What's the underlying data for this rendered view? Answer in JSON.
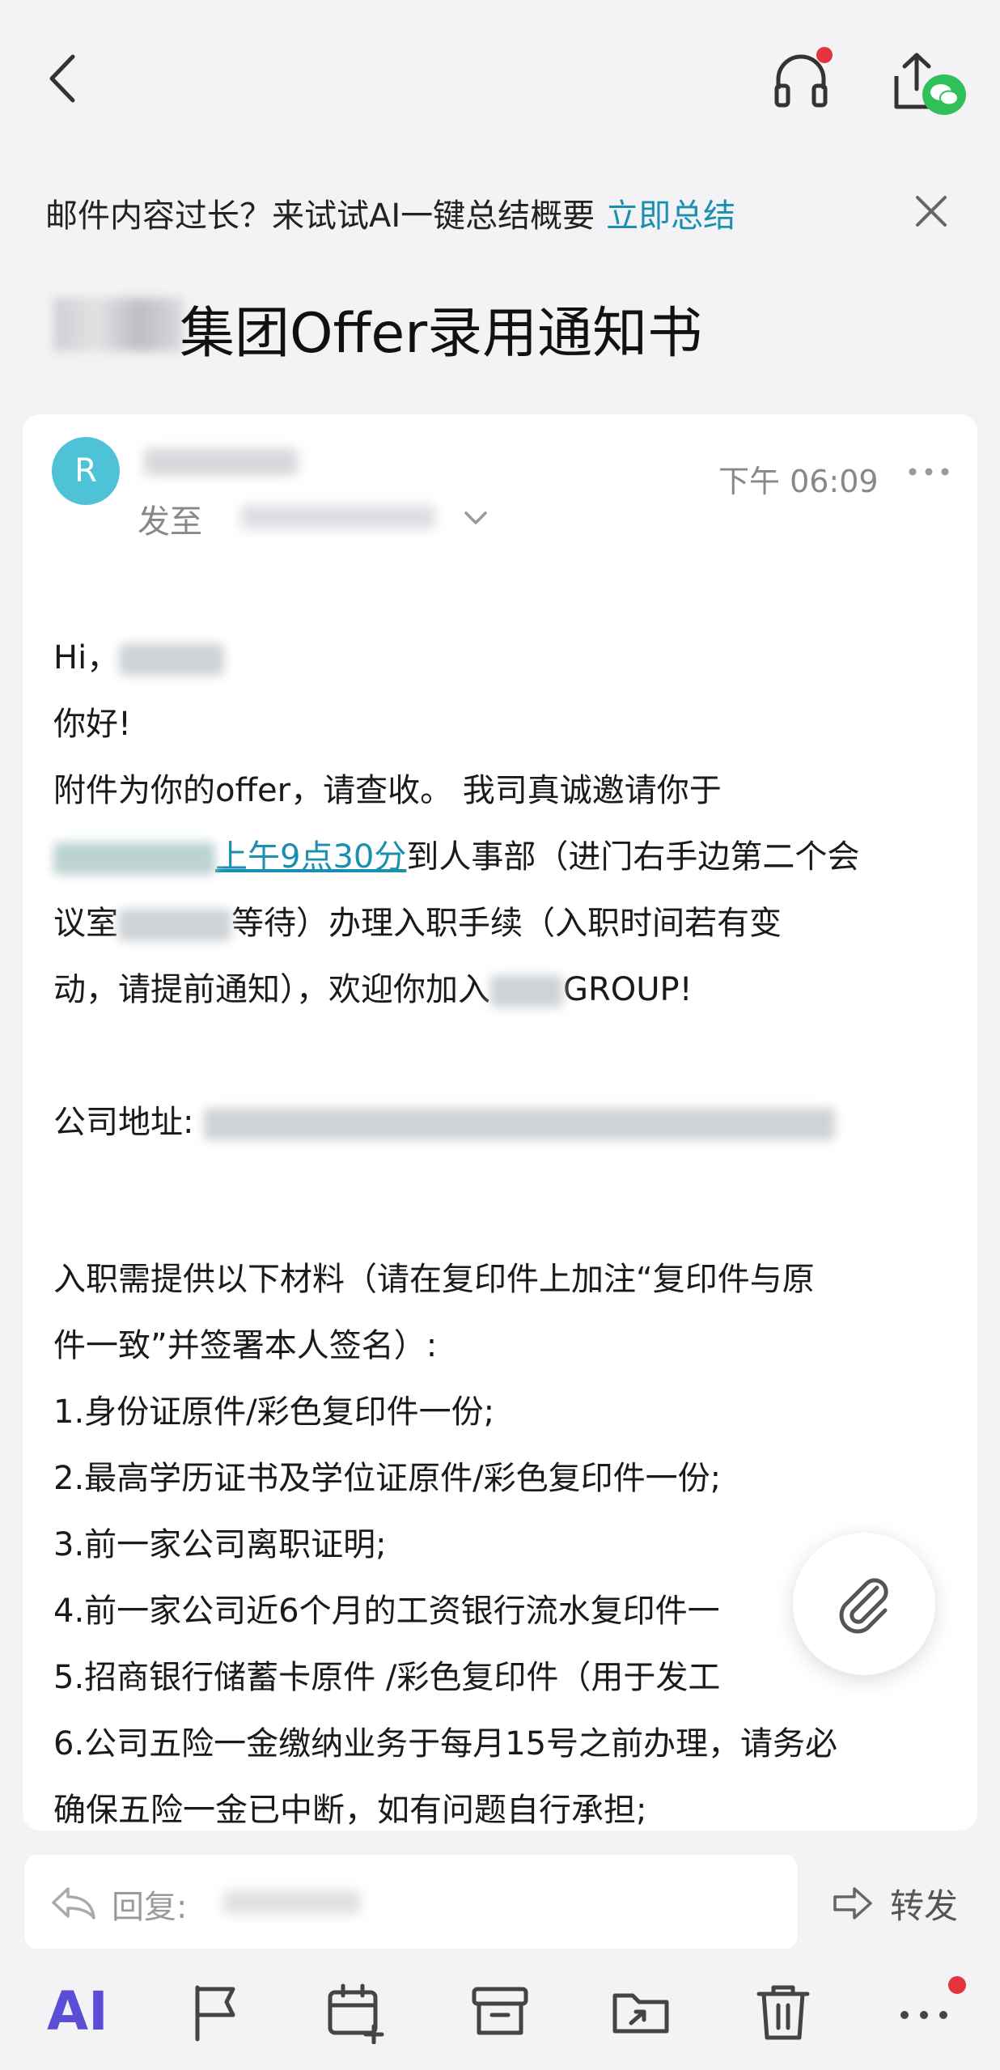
{
  "ai_tip": {
    "text": "邮件内容过长？来试试AI一键总结概要",
    "action": "立即总结"
  },
  "subject": "集团Offer录用通知书",
  "email": {
    "avatar_letter": "R",
    "time": "下午 06:09",
    "to_label": "发至",
    "body": {
      "greeting": "Hi，",
      "hello": "你好!",
      "line1": "附件为你的offer，请查收。 我司真诚邀请你于",
      "time_link": "上午9点30分",
      "line2_rest": "到人事部（进门右手边第二个会",
      "line3_a": "议室",
      "line3_b": "等待）办理入职手续（入职时间若有变",
      "line4_a": "动，请提前通知），欢迎你加入",
      "line4_b": "GROUP!",
      "address_label": "公司地址:",
      "materials_1": "入职需提供以下材料（请在复印件上加注“复印件与原",
      "materials_2": "件一致”并签署本人签名）:",
      "items": [
        "1.身份证原件/彩色复印件一份;",
        "2.最高学历证书及学位证原件/彩色复印件一份;",
        "3.前一家公司离职证明;",
        "4.前一家公司近6个月的工资银行流水复印件一",
        "5.招商银行储蓄卡原件 /彩色复印件（用于发工",
        "6.公司五险一金缴纳业务于每月15号之前办理，请务必",
        "确保五险一金已中断，如有问题自行承担;"
      ]
    }
  },
  "reply": {
    "label": "回复:"
  },
  "forward": {
    "label": "转发"
  },
  "toolbar": {
    "ai_label": "AI"
  },
  "colors": {
    "accent_link": "#1a8fb0",
    "avatar": "#4ec3d8",
    "ai_purple": "#5a4dd6",
    "badge_red": "#e5333f",
    "wechat_green": "#2fc05a"
  }
}
